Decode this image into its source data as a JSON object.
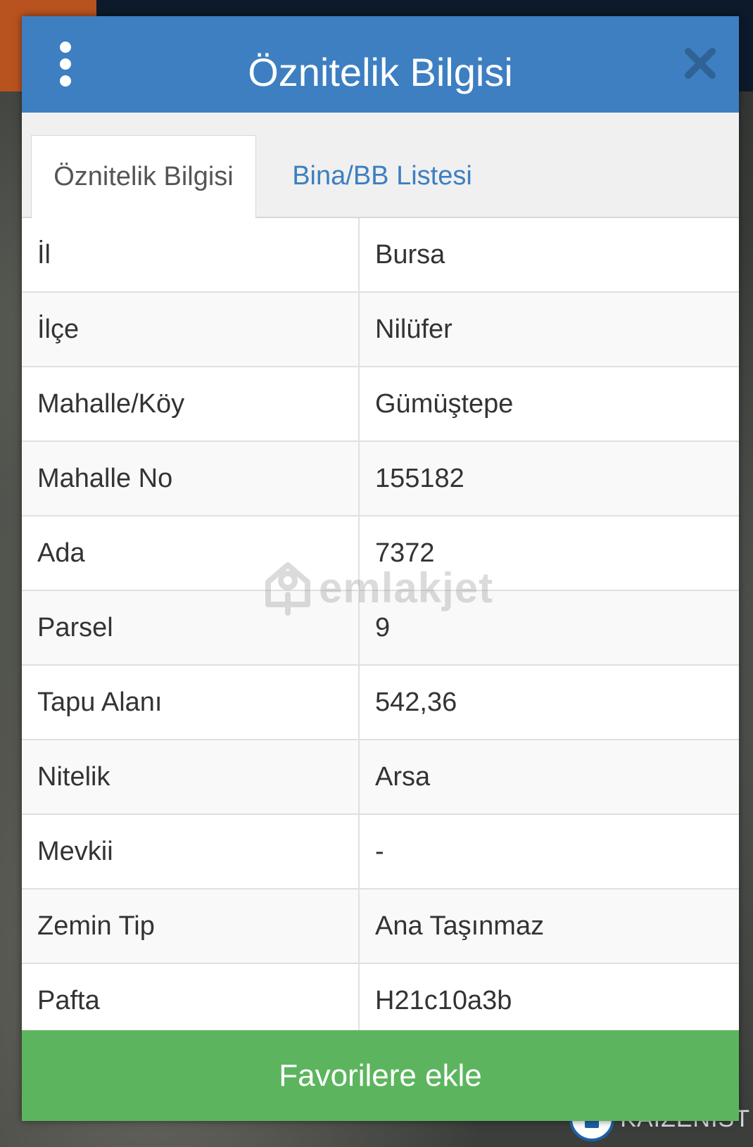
{
  "map": {
    "place_label": "KAIZENIST"
  },
  "header": {
    "title": "Öznitelik Bilgisi"
  },
  "tabs": [
    {
      "label": "Öznitelik Bilgisi",
      "active": true
    },
    {
      "label": "Bina/BB Listesi",
      "active": false
    }
  ],
  "attributes": [
    {
      "key": "İl",
      "value": "Bursa"
    },
    {
      "key": "İlçe",
      "value": "Nilüfer"
    },
    {
      "key": "Mahalle/Köy",
      "value": "Gümüştepe"
    },
    {
      "key": "Mahalle No",
      "value": "155182"
    },
    {
      "key": "Ada",
      "value": "7372"
    },
    {
      "key": "Parsel",
      "value": "9"
    },
    {
      "key": "Tapu Alanı",
      "value": "542,36"
    },
    {
      "key": "Nitelik",
      "value": "Arsa"
    },
    {
      "key": "Mevkii",
      "value": "-"
    },
    {
      "key": "Zemin Tip",
      "value": "Ana Taşınmaz"
    },
    {
      "key": "Pafta",
      "value": "H21c10a3b"
    }
  ],
  "watermark": "emlakjet",
  "footer": {
    "favorite_label": "Favorilere ekle"
  },
  "colors": {
    "header_blue": "#3d7fc1",
    "favorite_green": "#5cb55e",
    "tab_link": "#3d7fc1"
  }
}
